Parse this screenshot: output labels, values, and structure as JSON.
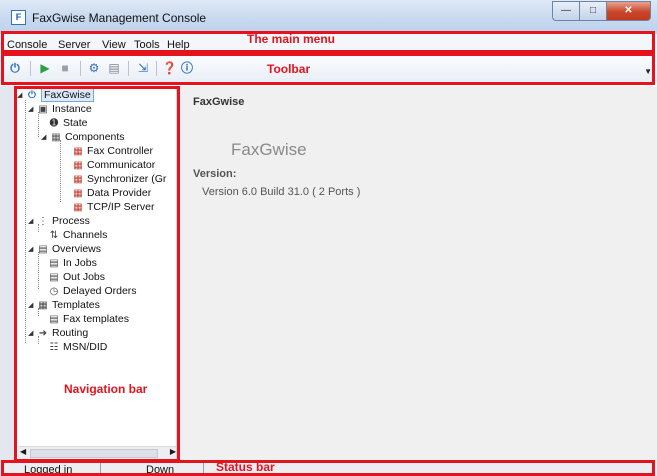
{
  "window": {
    "title": "FaxGwise Management Console",
    "icon_letter": "F"
  },
  "menu": {
    "items": [
      "Console",
      "Server",
      "View",
      "Tools",
      "Help"
    ]
  },
  "toolbar": {
    "icons": [
      "power-icon",
      "play-icon",
      "stop-icon",
      "gear-icon",
      "list-icon",
      "export-icon",
      "help-icon",
      "info-icon"
    ]
  },
  "annotations": {
    "main_menu": "The main menu",
    "toolbar": "Toolbar",
    "navigation_bar": "Navigation bar",
    "status_bar": "Status bar"
  },
  "tree": {
    "root": "FaxGwise",
    "instance": "Instance",
    "state": "State",
    "components": "Components",
    "fax_controller": "Fax Controller",
    "communicator": "Communicator",
    "synchronizer": "Synchronizer (Gr",
    "data_provider": "Data Provider",
    "tcpip_server": "TCP/IP Server",
    "process": "Process",
    "channels": "Channels",
    "overviews": "Overviews",
    "in_jobs": "In Jobs",
    "out_jobs": "Out Jobs",
    "delayed_orders": "Delayed Orders",
    "templates": "Templates",
    "fax_templates": "Fax templates",
    "routing": "Routing",
    "msn_did": "MSN/DID"
  },
  "main": {
    "header": "FaxGwise",
    "product_name": "FaxGwise",
    "version_label": "Version:",
    "version_value": "Version 6.0 Build 31.0  ( 2 Ports )"
  },
  "statusbar": {
    "login_status": "Logged in",
    "server_status": "Down"
  },
  "colors": {
    "annotation_red": "#e5131d",
    "selection_blue": "#dbe9f9",
    "component_red": "#c0392b"
  }
}
